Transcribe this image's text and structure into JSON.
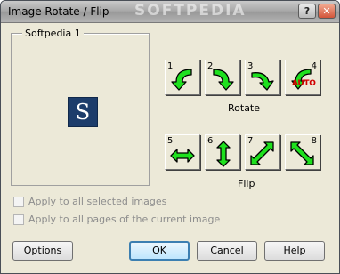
{
  "window": {
    "title": "Image Rotate / Flip",
    "watermark": "SOFTPEDIA",
    "help_glyph": "?",
    "close_glyph": "✕"
  },
  "preview": {
    "label": "Softpedia 1",
    "logo_letter": "S"
  },
  "rotate": {
    "label": "Rotate",
    "buttons": [
      {
        "number": "1",
        "icon": "rotate-left-arrow-icon"
      },
      {
        "number": "2",
        "icon": "rotate-right-arrow-icon"
      },
      {
        "number": "3",
        "icon": "rotate-down-arrow-icon"
      },
      {
        "number": "4",
        "icon": "auto-rotate-icon",
        "badge": "AUTO"
      }
    ]
  },
  "flip": {
    "label": "Flip",
    "buttons": [
      {
        "number": "5",
        "icon": "flip-horizontal-arrow-icon"
      },
      {
        "number": "6",
        "icon": "flip-vertical-arrow-icon"
      },
      {
        "number": "7",
        "icon": "flip-diagonal-arrow-icon"
      },
      {
        "number": "8",
        "icon": "flip-antidiagonal-arrow-icon"
      }
    ]
  },
  "options": {
    "apply_selected": "Apply to all selected images",
    "apply_pages": "Apply to all pages of the current image"
  },
  "buttons": {
    "options": "Options",
    "ok": "OK",
    "cancel": "Cancel",
    "help": "Help"
  },
  "colors": {
    "arrow_fill": "#1ee01e",
    "arrow_stroke": "#000000",
    "auto_badge": "#d10000"
  }
}
